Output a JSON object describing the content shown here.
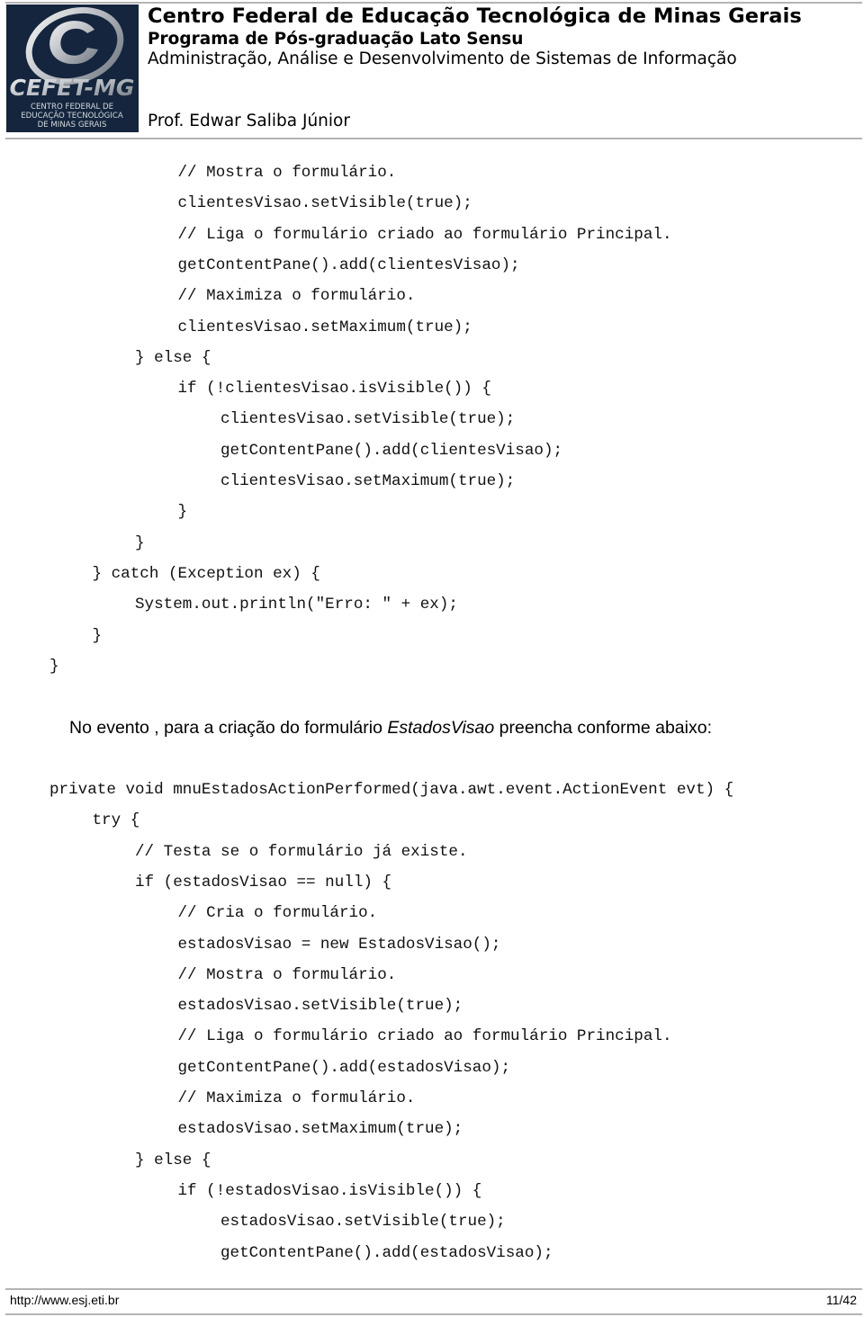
{
  "header": {
    "logo": {
      "icon": "cefet-mg-logo-icon",
      "wordmark": "CEFET-MG",
      "lines": [
        "CENTRO FEDERAL DE",
        "EDUCAÇÃO TECNOLÓGICA",
        "DE MINAS GERAIS"
      ]
    },
    "institution": "Centro Federal de Educação Tecnológica de Minas Gerais",
    "program": "Programa de Pós-graduação Lato Sensu",
    "course": "Administração, Análise e Desenvolvimento de Sistemas de Informação",
    "professor": "Prof. Edwar Saliba Júnior"
  },
  "code_block_1": {
    "lines": [
      {
        "indent": 3,
        "text": "// Mostra o formulário."
      },
      {
        "indent": 3,
        "text": "clientesVisao.setVisible(true);"
      },
      {
        "indent": 3,
        "text": "// Liga o formulário criado ao formulário Principal."
      },
      {
        "indent": 3,
        "text": "getContentPane().add(clientesVisao);"
      },
      {
        "indent": 3,
        "text": "// Maximiza o formulário."
      },
      {
        "indent": 3,
        "text": "clientesVisao.setMaximum(true);"
      },
      {
        "indent": 2,
        "text": "} else {"
      },
      {
        "indent": 3,
        "text": "if (!clientesVisao.isVisible()) {"
      },
      {
        "indent": 4,
        "text": "clientesVisao.setVisible(true);"
      },
      {
        "indent": 4,
        "text": "getContentPane().add(clientesVisao);"
      },
      {
        "indent": 4,
        "text": "clientesVisao.setMaximum(true);"
      },
      {
        "indent": 3,
        "text": "}"
      },
      {
        "indent": 2,
        "text": "}"
      },
      {
        "indent": 1,
        "text": "} catch (Exception ex) {"
      },
      {
        "indent": 2,
        "text": "System.out.println(\"Erro: \" + ex);"
      },
      {
        "indent": 1,
        "text": "}"
      },
      {
        "indent": 0,
        "text": "}"
      }
    ]
  },
  "paragraph": {
    "before": "No evento , para a criação do formulário ",
    "emphasis": "EstadosVisao",
    "after": " preencha conforme abaixo:"
  },
  "code_block_2": {
    "lines": [
      {
        "indent": 0,
        "text": "private void mnuEstadosActionPerformed(java.awt.event.ActionEvent evt) {"
      },
      {
        "indent": 1,
        "text": "try {"
      },
      {
        "indent": 2,
        "text": "// Testa se o formulário já existe."
      },
      {
        "indent": 2,
        "text": "if (estadosVisao == null) {"
      },
      {
        "indent": 3,
        "text": "// Cria o formulário."
      },
      {
        "indent": 3,
        "text": "estadosVisao = new EstadosVisao();"
      },
      {
        "indent": 3,
        "text": "// Mostra o formulário."
      },
      {
        "indent": 3,
        "text": "estadosVisao.setVisible(true);"
      },
      {
        "indent": 3,
        "text": "// Liga o formulário criado ao formulário Principal."
      },
      {
        "indent": 3,
        "text": "getContentPane().add(estadosVisao);"
      },
      {
        "indent": 3,
        "text": "// Maximiza o formulário."
      },
      {
        "indent": 3,
        "text": "estadosVisao.setMaximum(true);"
      },
      {
        "indent": 2,
        "text": "} else {"
      },
      {
        "indent": 3,
        "text": "if (!estadosVisao.isVisible()) {"
      },
      {
        "indent": 4,
        "text": "estadosVisao.setVisible(true);"
      },
      {
        "indent": 4,
        "text": "getContentPane().add(estadosVisao);"
      }
    ]
  },
  "footer": {
    "url": "http://www.esj.eti.br",
    "page": "11/42"
  }
}
